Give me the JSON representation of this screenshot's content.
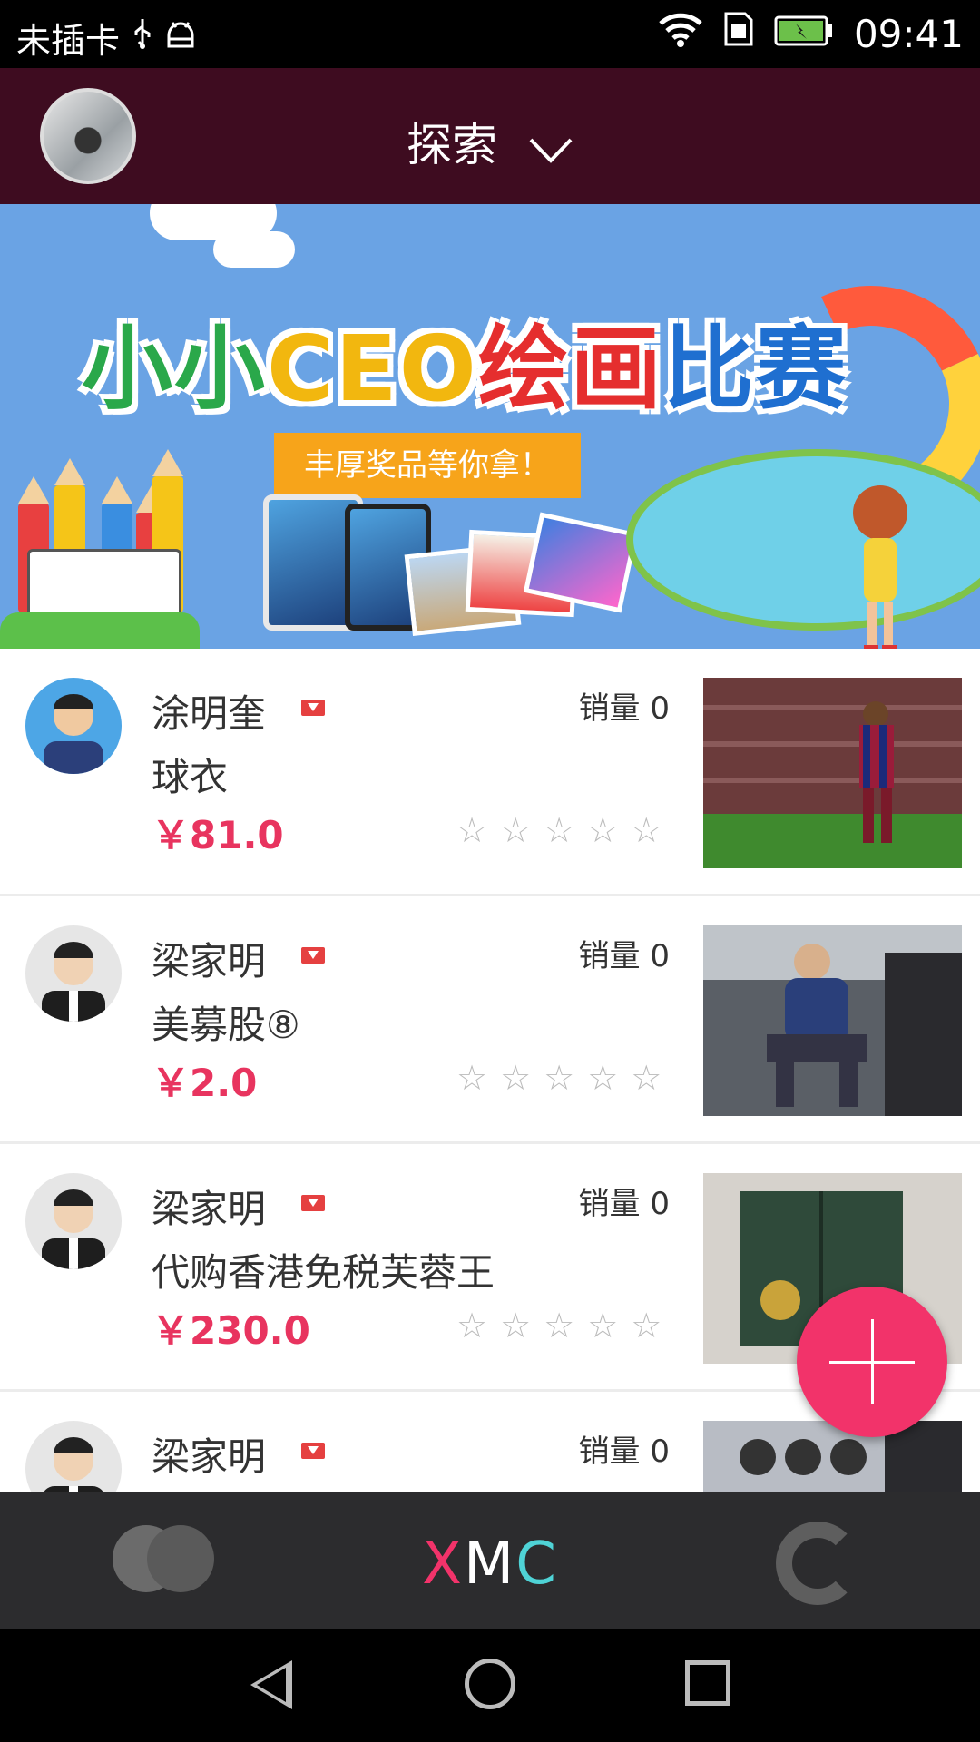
{
  "status_bar": {
    "carrier": "未插卡",
    "time": "09:41"
  },
  "header": {
    "title": "探索"
  },
  "banner": {
    "title_parts": [
      {
        "text": "小小",
        "color": "#2aa84a"
      },
      {
        "text": "CEO",
        "color": "#f2b70f"
      },
      {
        "text": "绘画",
        "color": "#e52e2e"
      },
      {
        "text": "比赛",
        "color": "#1f6fd0"
      }
    ],
    "cta": "丰厚奖品等你拿！"
  },
  "feed": {
    "sales_label": "销量",
    "items": [
      {
        "seller": "涂明奎",
        "title": "球衣",
        "price": "￥81.0",
        "sales": "0",
        "stars": "☆☆☆☆☆",
        "rating": 0
      },
      {
        "seller": "梁家明",
        "title": "美募股⑧",
        "price": "￥2.0",
        "sales": "0",
        "stars": "☆☆☆☆☆",
        "rating": 0
      },
      {
        "seller": "梁家明",
        "title": "代购香港免税芙蓉王",
        "price": "￥230.0",
        "sales": "0",
        "stars": "☆☆☆☆☆",
        "rating": 0
      },
      {
        "seller": "梁家明",
        "title": "",
        "price": "",
        "sales": "0",
        "stars": "",
        "rating": 0
      }
    ]
  },
  "tab_bar": {
    "logo": [
      "X",
      "M",
      "C"
    ],
    "logo_colors": [
      "#f2336a",
      "#ffffff",
      "#4fd3d6"
    ]
  },
  "colors": {
    "header_bg": "#3e0c20",
    "price": "#e8345f",
    "fab": "#f2336a",
    "tab_bg": "#2c2c2e"
  }
}
